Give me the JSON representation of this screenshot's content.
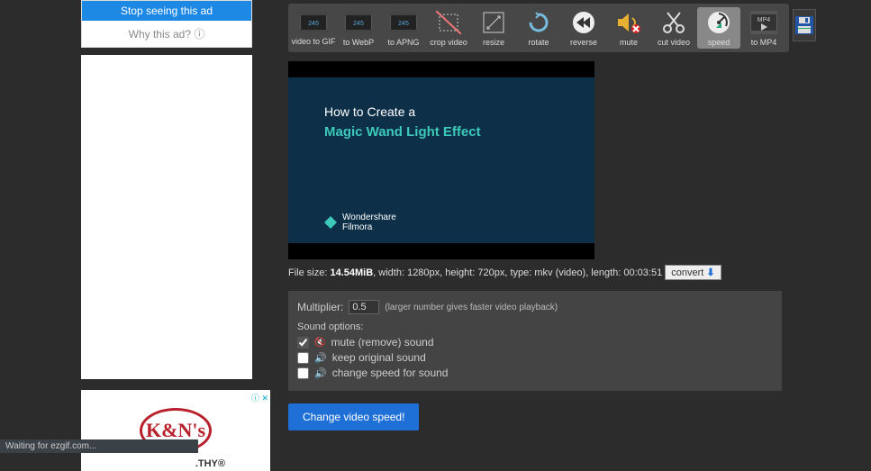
{
  "ad": {
    "stop": "Stop seeing this ad",
    "why": "Why this ad? ⓘ",
    "kn": "K&N's",
    "thy": ".THY®"
  },
  "toolbar": {
    "items": [
      {
        "label": "video to GIF"
      },
      {
        "label": "to WebP"
      },
      {
        "label": "to APNG"
      },
      {
        "label": "crop video"
      },
      {
        "label": "resize"
      },
      {
        "label": "rotate"
      },
      {
        "label": "reverse"
      },
      {
        "label": "mute"
      },
      {
        "label": "cut video"
      },
      {
        "label": "speed"
      },
      {
        "label": "to MP4"
      }
    ]
  },
  "video": {
    "title": "How to Create a",
    "subtitle": "Magic Wand Light Effect",
    "brand1": "Wondershare",
    "brand2": "Filmora"
  },
  "fileinfo": {
    "prefix": "File size: ",
    "size": "14.54MiB",
    "rest": ", width: 1280px, height: 720px, type: mkv (video), length: 00:03:51",
    "convert": "convert"
  },
  "options": {
    "multiplier_label": "Multiplier:",
    "multiplier_value": "0.5",
    "hint": "(larger number gives faster video playback)",
    "sound_head": "Sound options:",
    "opt1": "mute (remove) sound",
    "opt2": "keep original sound",
    "opt3": "change speed for sound"
  },
  "submit": "Change video speed!",
  "status": "Waiting for ezgif.com..."
}
